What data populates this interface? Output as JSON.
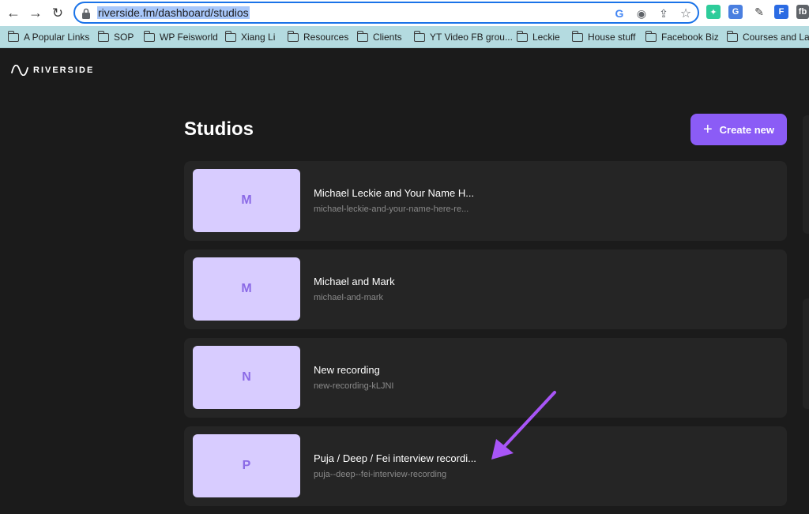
{
  "browser": {
    "url_host": "riverside.fm",
    "url_path": "/dashboard/studios",
    "bookmarks": [
      "A Popular Links",
      "SOP",
      "WP Feisworld",
      "Xiang Li",
      "Resources",
      "Clients",
      "YT Video FB grou...",
      "Leckie",
      "House stuff",
      "Facebook Biz",
      "Courses and Lan"
    ]
  },
  "app": {
    "logo_text": "RIVERSIDE",
    "page_title": "Studios",
    "create_label": "Create new",
    "studios": [
      {
        "initial": "M",
        "name": "Michael Leckie and Your Name H...",
        "slug": "michael-leckie-and-your-name-here-re..."
      },
      {
        "initial": "M",
        "name": "Michael and Mark",
        "slug": "michael-and-mark"
      },
      {
        "initial": "N",
        "name": "New recording",
        "slug": "new-recording-kLJNI"
      },
      {
        "initial": "P",
        "name": "Puja / Deep / Fei interview recordi...",
        "slug": "puja--deep--fei-interview-recording"
      }
    ]
  },
  "colors": {
    "accent": "#8b5cf6",
    "thumb": "#d8ccff",
    "annotation_arrow": "#a855f7"
  }
}
